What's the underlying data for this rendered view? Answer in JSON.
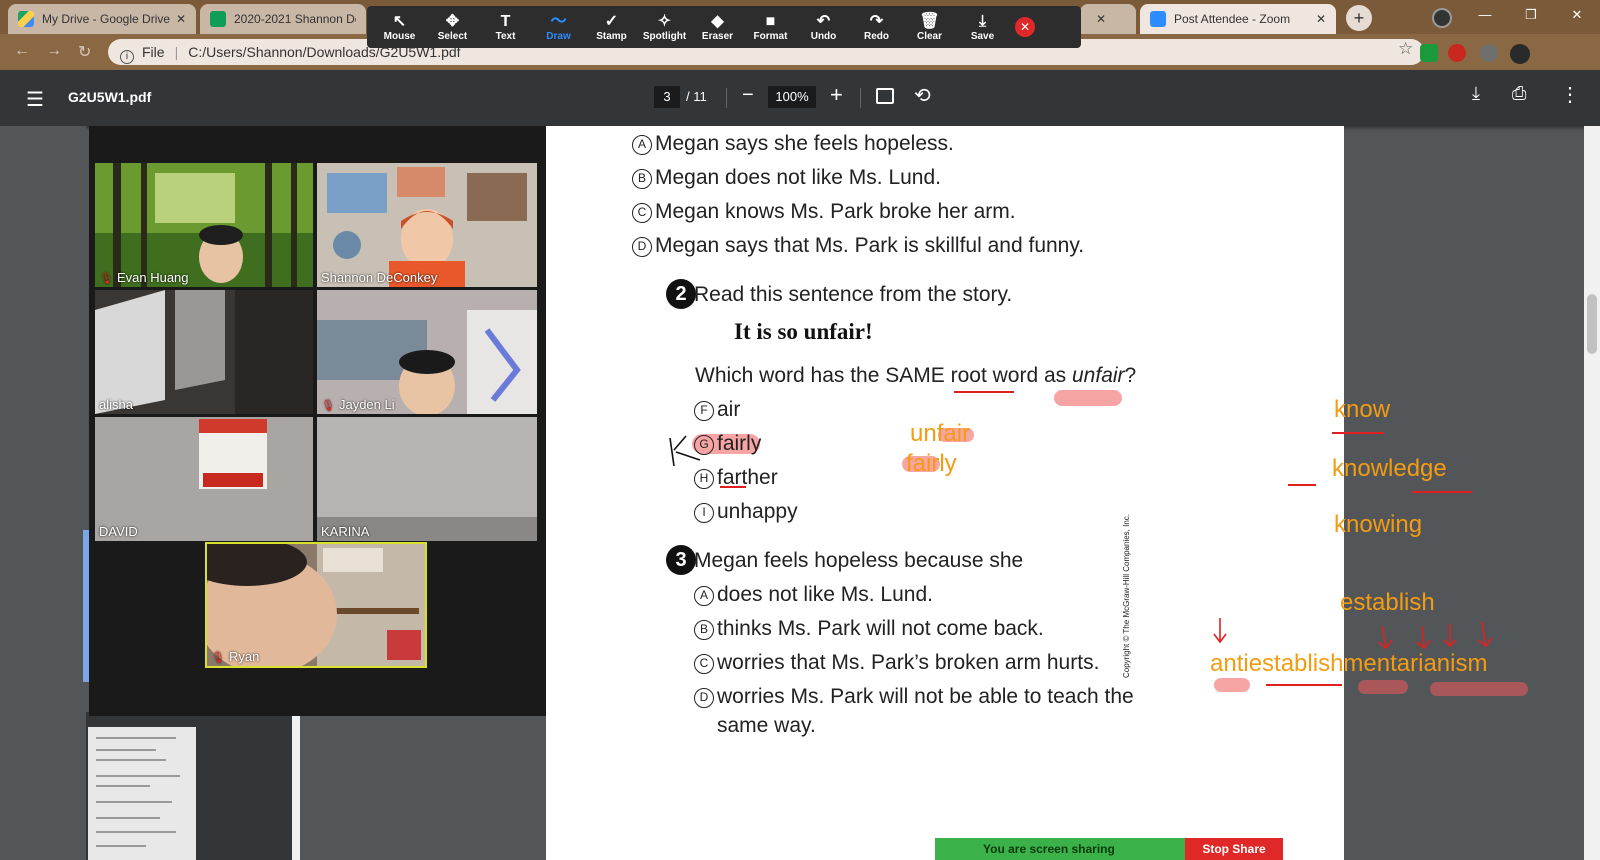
{
  "tabs": [
    {
      "title": "My Drive - Google Drive",
      "close": "✕"
    },
    {
      "title": "2020-2021 Shannon De",
      "close": ""
    },
    {
      "title": "",
      "close": "✕"
    },
    {
      "title": "Post Attendee - Zoom",
      "close": "✕"
    }
  ],
  "address": {
    "file_label": "File",
    "url": "C:/Users/Shannon/Downloads/G2U5W1.pdf"
  },
  "zoom_toolbar": [
    {
      "label": "Mouse",
      "icon": "↖",
      "active": false
    },
    {
      "label": "Select",
      "icon": "✥",
      "active": false
    },
    {
      "label": "Text",
      "icon": "T",
      "active": false
    },
    {
      "label": "Draw",
      "icon": "〜",
      "active": true
    },
    {
      "label": "Stamp",
      "icon": "✓",
      "active": false
    },
    {
      "label": "Spotlight",
      "icon": "✧",
      "active": false
    },
    {
      "label": "Eraser",
      "icon": "◆",
      "active": false
    },
    {
      "label": "Format",
      "icon": "■",
      "active": false
    },
    {
      "label": "Undo",
      "icon": "↶",
      "active": false
    },
    {
      "label": "Redo",
      "icon": "↷",
      "active": false
    },
    {
      "label": "Clear",
      "icon": "🗑",
      "active": false
    },
    {
      "label": "Save",
      "icon": "⤓",
      "active": false
    }
  ],
  "pdf": {
    "filename": "G2U5W1.pdf",
    "current_page": "3",
    "total_pages": "/ 11",
    "zoom": "100%"
  },
  "participants": [
    {
      "name": "Evan Huang",
      "muted": true,
      "bg": "#4e7a22"
    },
    {
      "name": "Shannon DeConkey",
      "muted": false,
      "bg": "#b8a898"
    },
    {
      "name": "alisha",
      "muted": false,
      "bg": "#3a3634"
    },
    {
      "name": "Jayden Li",
      "muted": true,
      "bg": "#8a8282"
    },
    {
      "name": "DAVID",
      "muted": false,
      "bg": "#9a9694"
    },
    {
      "name": "KARINA",
      "muted": false,
      "bg": "#a8a6a4"
    },
    {
      "name": "Ryan",
      "muted": true,
      "bg": "#7a6a5a"
    }
  ],
  "page": {
    "q1_options": [
      {
        "letter": "A",
        "text": "Megan says she feels hopeless."
      },
      {
        "letter": "B",
        "text": "Megan does not like Ms. Lund."
      },
      {
        "letter": "C",
        "text": "Megan knows Ms. Park broke her arm."
      },
      {
        "letter": "D",
        "text": "Megan says that Ms. Park is skillful and funny."
      }
    ],
    "q2_number": "2",
    "q2_prompt": "Read this sentence from the story.",
    "q2_sentence": "It is so unfair!",
    "q2_question_start": "Which word has the SAME root word as ",
    "q2_question_word": "unfair",
    "q2_question_end": "?",
    "q2_options": [
      {
        "letter": "F",
        "text": "air"
      },
      {
        "letter": "G",
        "text": "fairly"
      },
      {
        "letter": "H",
        "text": "farther"
      },
      {
        "letter": "I",
        "text": "unhappy"
      }
    ],
    "q3_number": "3",
    "q3_prompt": "Megan feels hopeless because she",
    "q3_options": [
      {
        "letter": "A",
        "text": "does not like Ms. Lund."
      },
      {
        "letter": "B",
        "text": "thinks Ms. Park will not come back."
      },
      {
        "letter": "C",
        "text": "worries that Ms. Park’s broken arm hurts."
      },
      {
        "letter": "D",
        "text": "worries Ms. Park will not be able to teach the"
      }
    ],
    "q3_option_d_cont": "same way.",
    "copyright": "Copyright © The McGraw-Hill Companies, Inc."
  },
  "annotations": {
    "mid": [
      "unfair",
      "fairly"
    ],
    "right": [
      "know",
      "knowledge",
      "knowing",
      "establish",
      "antiestablishmentarianism"
    ]
  },
  "sharing": {
    "status": "You are screen sharing",
    "stop": "Stop Share"
  }
}
